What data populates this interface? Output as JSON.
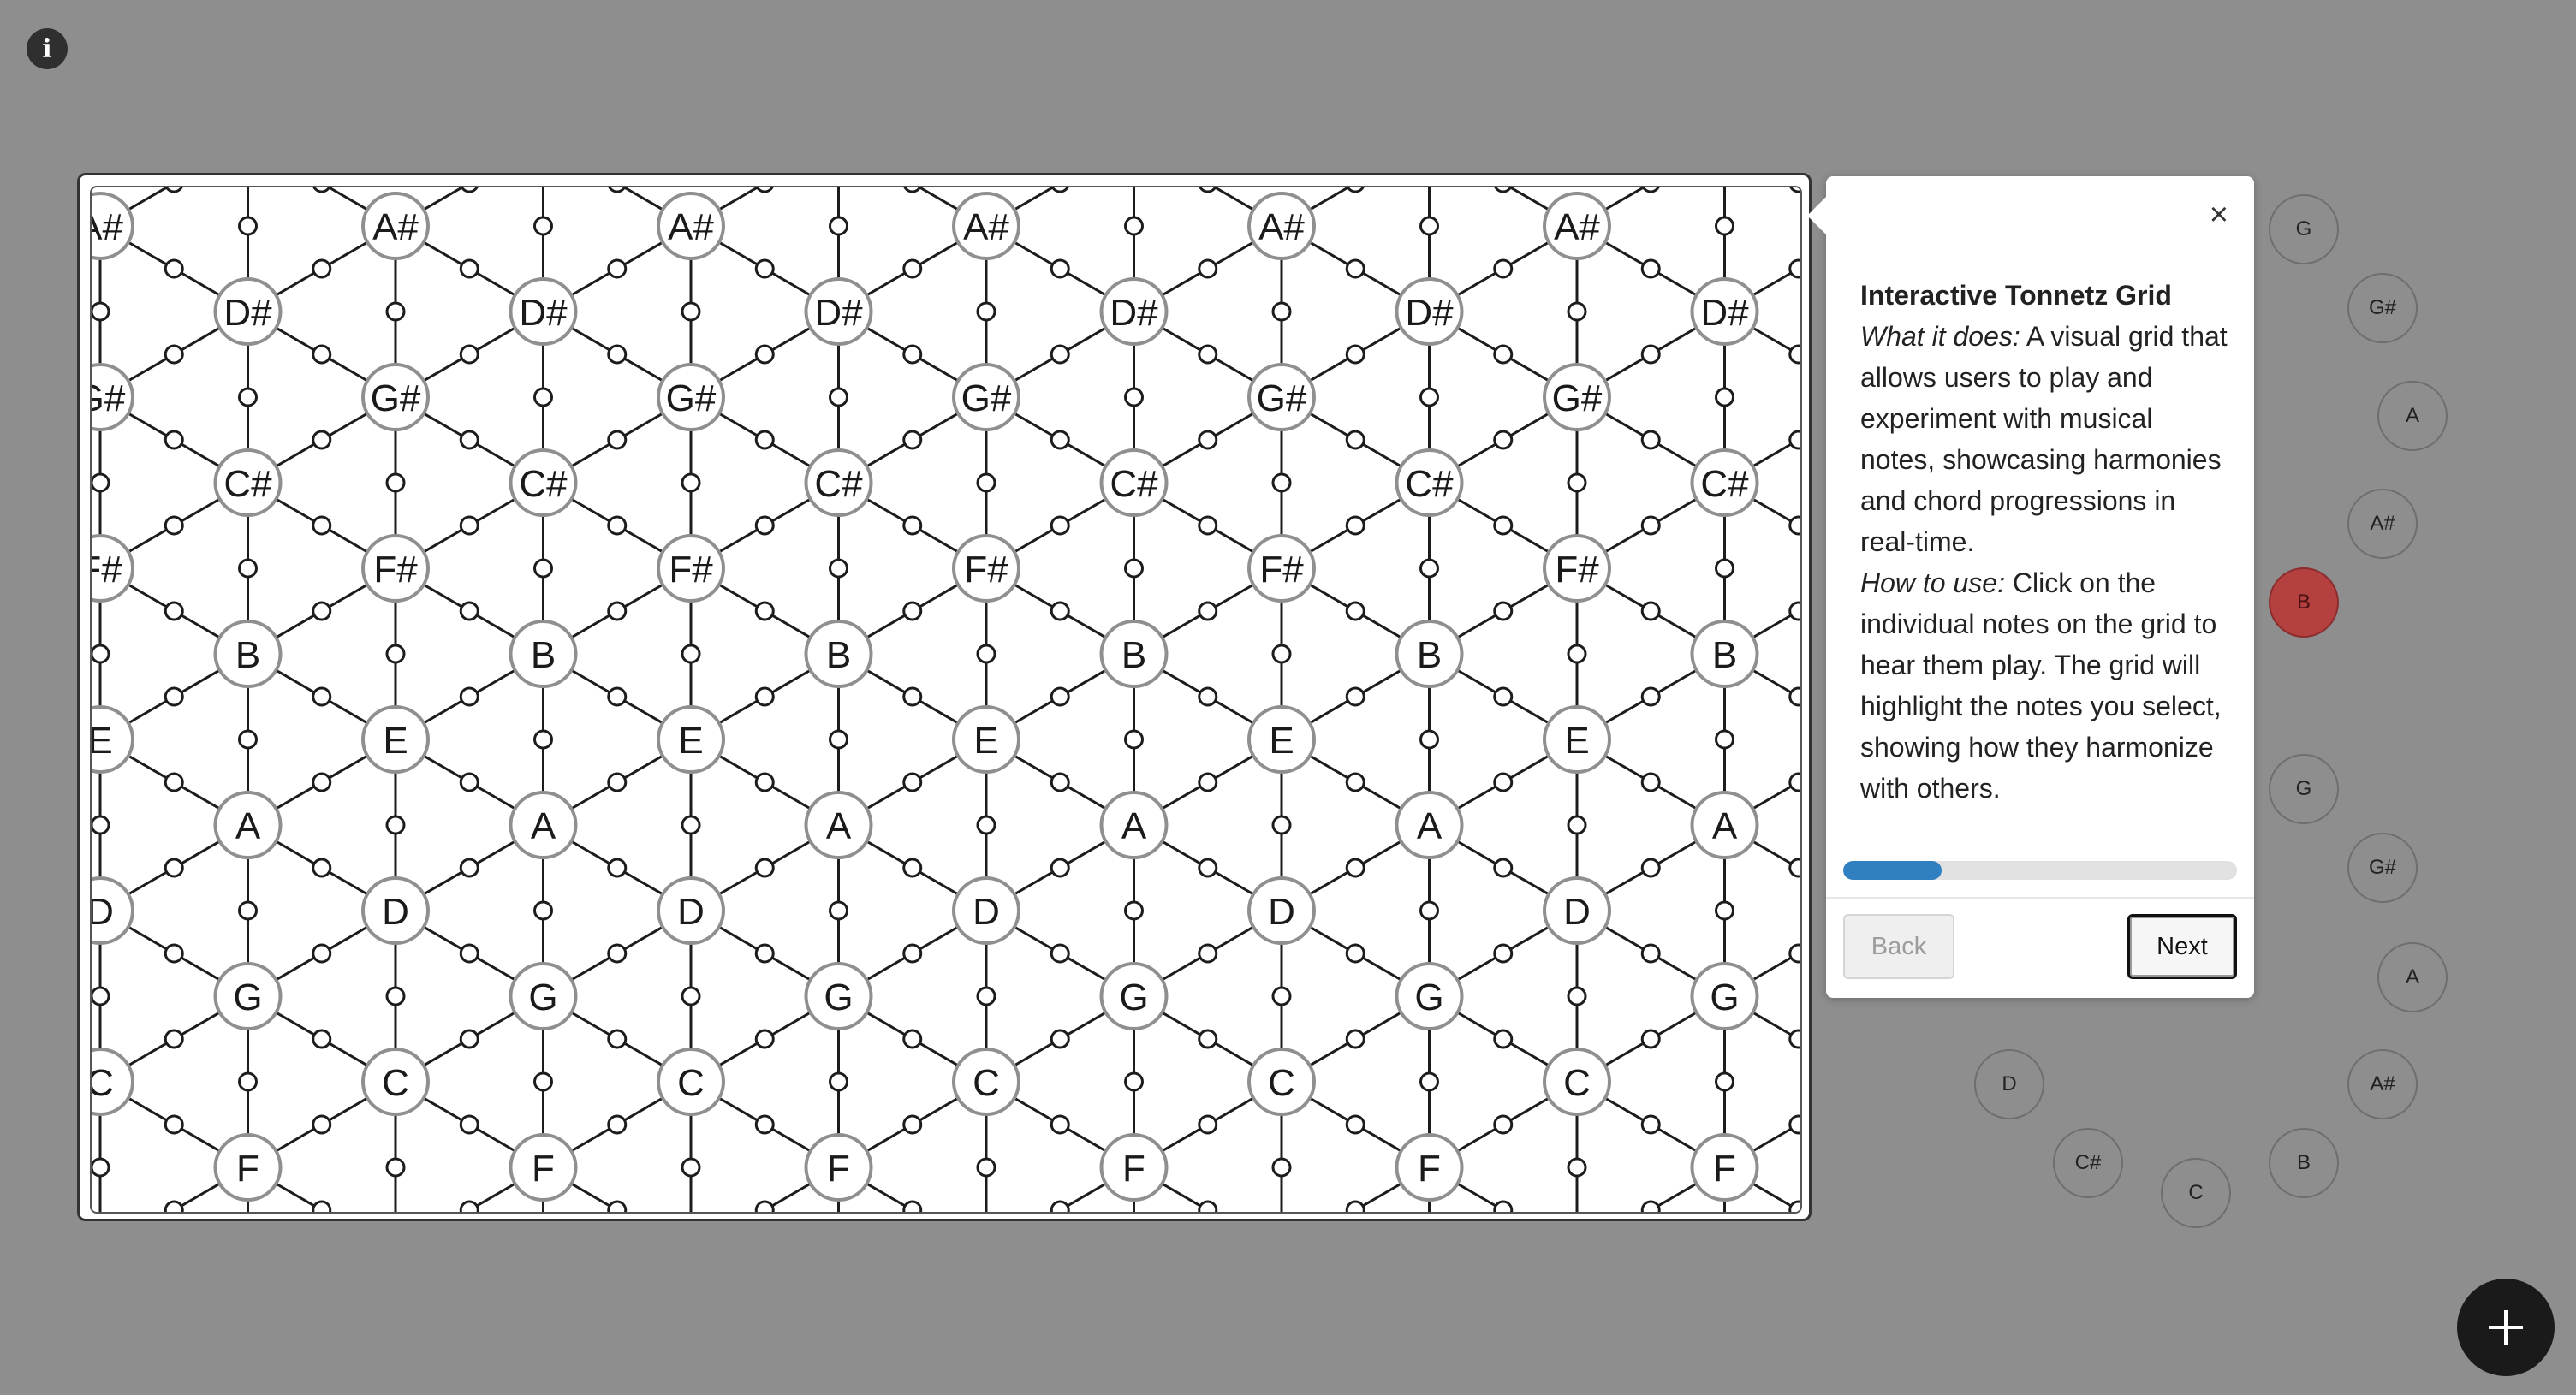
{
  "info_button": {
    "glyph": "i",
    "icon": "info-icon"
  },
  "grid": {
    "notes": [
      "C",
      "C#",
      "D",
      "D#",
      "E",
      "F",
      "F#",
      "G",
      "G#",
      "A",
      "A#",
      "B"
    ]
  },
  "wheel": {
    "active_note": "B",
    "notes": [
      {
        "label": "G",
        "state": "idle"
      },
      {
        "label": "G#",
        "state": "idle"
      },
      {
        "label": "A",
        "state": "idle"
      },
      {
        "label": "A#",
        "state": "idle"
      },
      {
        "label": "B",
        "state": "active"
      },
      {
        "label": "G",
        "state": "idle"
      },
      {
        "label": "G#",
        "state": "idle"
      },
      {
        "label": "A",
        "state": "idle"
      },
      {
        "label": "A#",
        "state": "idle"
      },
      {
        "label": "B",
        "state": "idle"
      },
      {
        "label": "C",
        "state": "idle"
      },
      {
        "label": "C#",
        "state": "idle"
      },
      {
        "label": "D",
        "state": "idle"
      }
    ]
  },
  "tour": {
    "close_glyph": "×",
    "title": "Interactive Tonnetz Grid",
    "what_label": "What it does:",
    "what_text": " A visual grid that allows users to play and experiment with musical notes, showcasing harmonies and chord progressions in real-time.",
    "how_label": "How to use:",
    "how_text": " Click on the individual notes on the grid to hear them play. The grid will highlight the notes you select, showing how they harmonize with others.",
    "progress_fraction": 0.25,
    "progress_color": "#2f7fc1",
    "back_label": "Back",
    "next_label": "Next"
  },
  "fab": {
    "icon": "plus-icon"
  },
  "colors": {
    "background": "#8e8e8e",
    "active_note": "#b4403f"
  }
}
